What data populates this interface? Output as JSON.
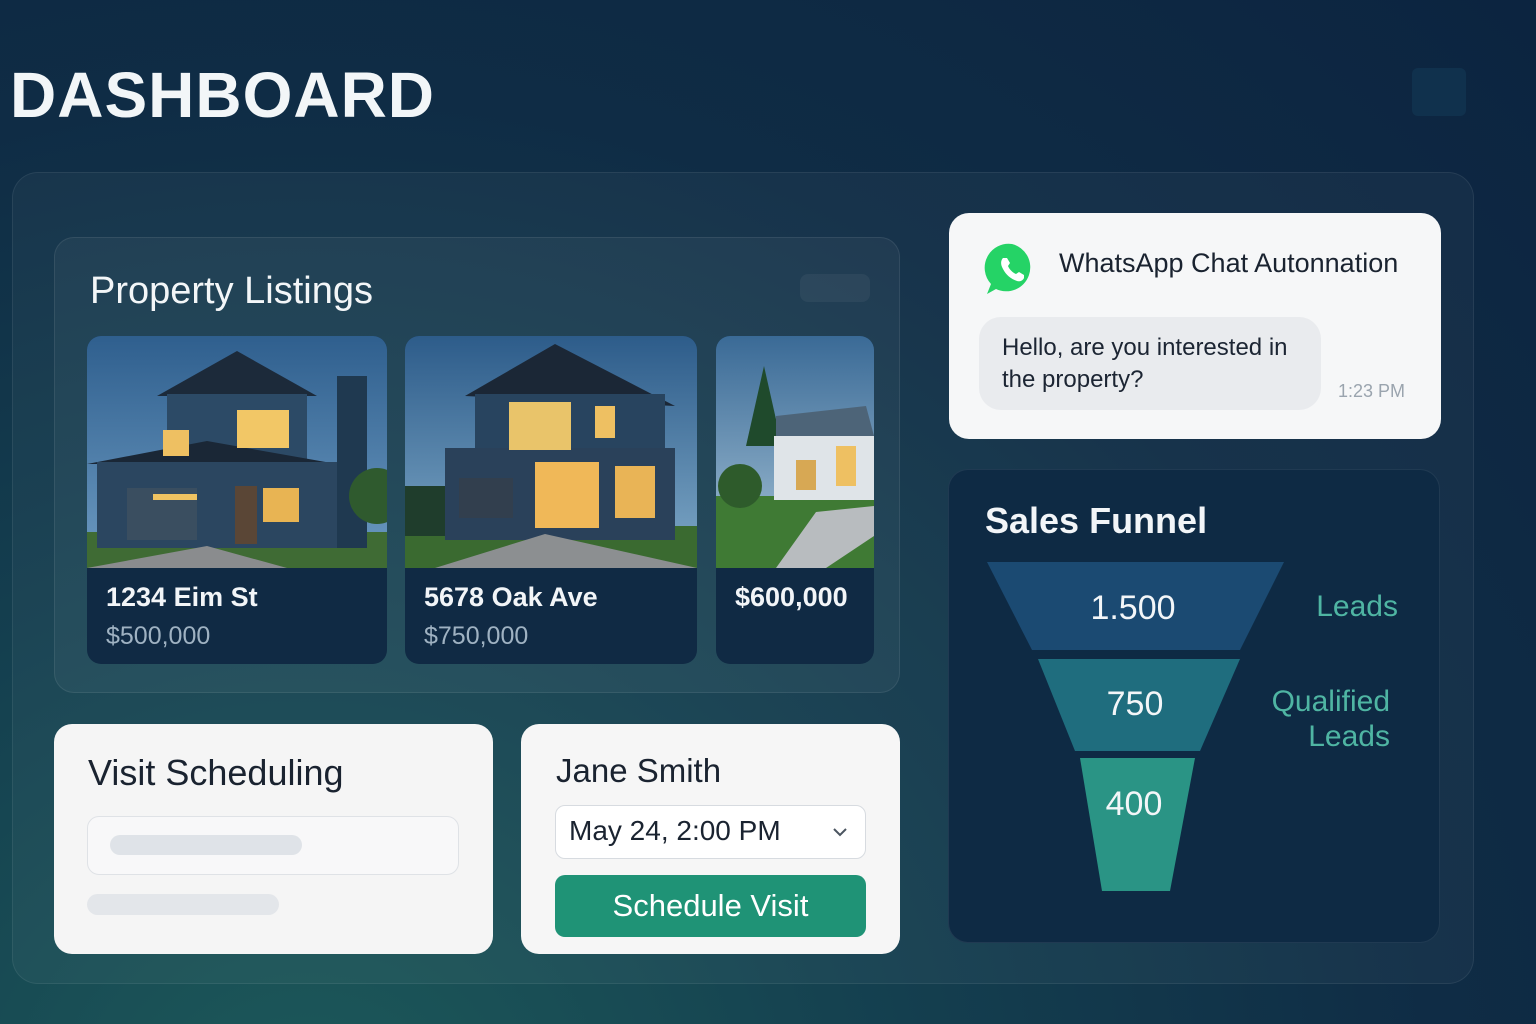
{
  "header": {
    "title": "DASHBOARD"
  },
  "listings": {
    "title": "Property Listings",
    "items": [
      {
        "address": "1234 Eim St",
        "price": "$500,000"
      },
      {
        "address": "5678 Oak Ave",
        "price": "$750,000"
      },
      {
        "address": "",
        "price": "$600,000"
      }
    ]
  },
  "whatsapp": {
    "title": "WhatsApp Chat Autonnation",
    "message": "Hello, are you interested in the property?",
    "time": "1:23 PM",
    "brand_color": "#25D366"
  },
  "funnel": {
    "title": "Sales Funnel",
    "stages": [
      {
        "value": "1.500",
        "label": "Leads",
        "color": "#1b4a72"
      },
      {
        "value": "750",
        "label": "Qualified Leads",
        "color": "#1f6d7e"
      },
      {
        "value": "400",
        "label": "",
        "color": "#2a9485"
      }
    ]
  },
  "visit": {
    "title": "Visit Scheduling"
  },
  "schedule": {
    "agent_name": "Jane Smith",
    "date_value": "May 24, 2:00 PM",
    "button_label": "Schedule Visit",
    "button_color": "#1f9376"
  }
}
